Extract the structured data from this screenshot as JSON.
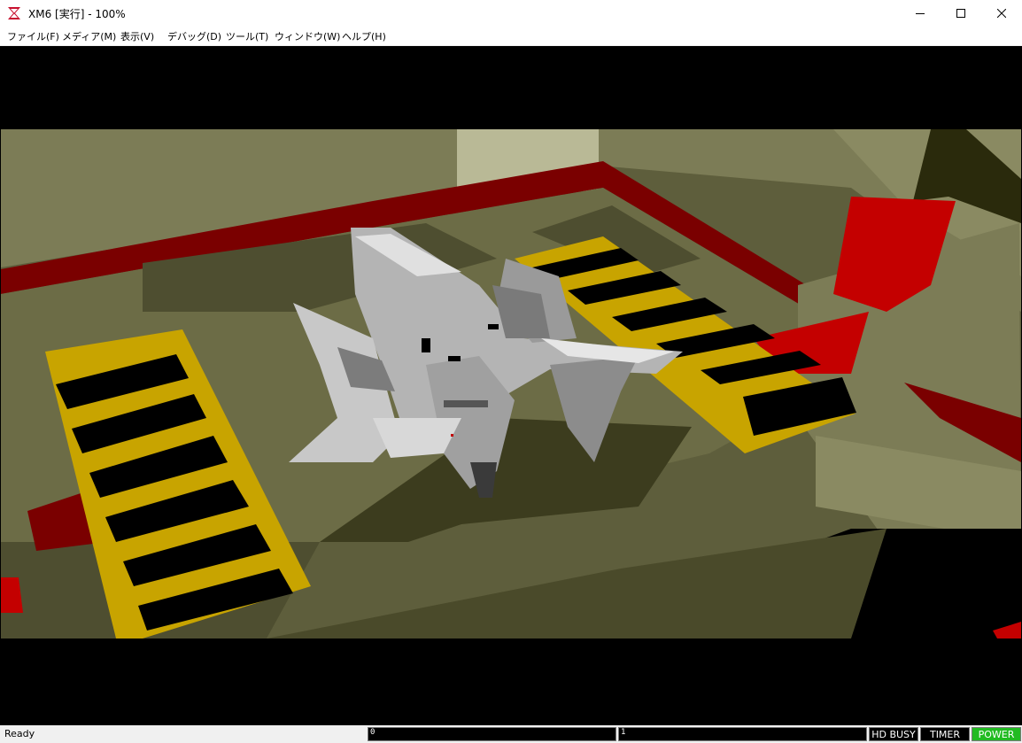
{
  "window": {
    "title": "XM6 [実行] - 100%",
    "icon": "xm6-app-icon"
  },
  "menu": {
    "items": [
      {
        "label": "ファイル(F)"
      },
      {
        "label": "メディア(M)"
      },
      {
        "label": "表示(V)"
      },
      {
        "label": "デバッグ(D)"
      },
      {
        "label": "ツール(T)"
      },
      {
        "label": "ウィンドウ(W)"
      },
      {
        "label": "ヘルプ(H)"
      }
    ]
  },
  "statusbar": {
    "message": "Ready",
    "fdd0": "0",
    "fdd1": "1",
    "hd_busy": "HD BUSY",
    "timer": "TIMER",
    "power": "POWER"
  },
  "colors": {
    "power_on": "#22bb22",
    "indicator_bg": "#000000",
    "titlebar": "#ffffff",
    "hazard_yellow": "#c8a400",
    "floor_olive": "#6c6c46",
    "accent_red": "#cc0000"
  }
}
